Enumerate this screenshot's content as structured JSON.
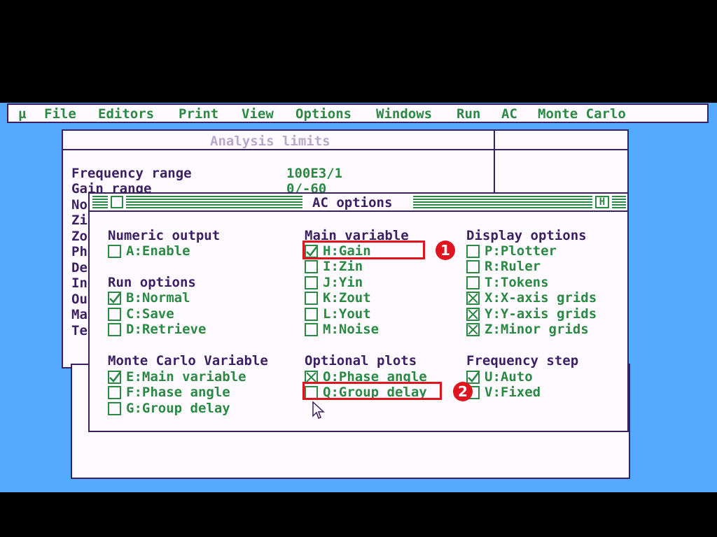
{
  "menubar": {
    "items": [
      {
        "label": "µ"
      },
      {
        "label": "File"
      },
      {
        "label": "Editors"
      },
      {
        "label": "Print"
      },
      {
        "label": "View"
      },
      {
        "label": "Options"
      },
      {
        "label": "Windows"
      },
      {
        "label": "Run"
      },
      {
        "label": "AC"
      },
      {
        "label": "Monte Carlo"
      }
    ]
  },
  "analysis_limits": {
    "title": "Analysis limits",
    "rows": [
      {
        "label": "Frequency range",
        "value": "100E3/1"
      },
      {
        "label": "Gain range",
        "value": "0/-60"
      }
    ],
    "clipped_labels": [
      "No",
      "Zi",
      "Zo",
      "Ph",
      "De",
      "In",
      "Ou",
      "Ma",
      "Te"
    ]
  },
  "dialog": {
    "title": "AC options",
    "help_label": "H",
    "groups": {
      "numeric_output": {
        "header": "Numeric output",
        "items": [
          {
            "label": "A:Enable",
            "state": "unchecked"
          }
        ]
      },
      "run_options": {
        "header": "Run options",
        "items": [
          {
            "label": "B:Normal",
            "state": "checked"
          },
          {
            "label": "C:Save",
            "state": "unchecked"
          },
          {
            "label": "D:Retrieve",
            "state": "unchecked"
          }
        ]
      },
      "monte_carlo_variable": {
        "header": "Monte Carlo Variable",
        "items": [
          {
            "label": "E:Main variable",
            "state": "checked"
          },
          {
            "label": "F:Phase angle",
            "state": "unchecked"
          },
          {
            "label": "G:Group delay",
            "state": "unchecked"
          }
        ]
      },
      "main_variable": {
        "header": "Main variable",
        "items": [
          {
            "label": "H:Gain",
            "state": "checked"
          },
          {
            "label": "I:Zin",
            "state": "unchecked"
          },
          {
            "label": "J:Yin",
            "state": "unchecked"
          },
          {
            "label": "K:Zout",
            "state": "unchecked"
          },
          {
            "label": "L:Yout",
            "state": "unchecked"
          },
          {
            "label": "M:Noise",
            "state": "unchecked"
          }
        ]
      },
      "optional_plots": {
        "header": "Optional plots",
        "items": [
          {
            "label": "O:Phase angle",
            "state": "crossed"
          },
          {
            "label": "Q:Group delay",
            "state": "unchecked"
          }
        ]
      },
      "display_options": {
        "header": "Display options",
        "items": [
          {
            "label": "P:Plotter",
            "state": "unchecked"
          },
          {
            "label": "R:Ruler",
            "state": "unchecked"
          },
          {
            "label": "T:Tokens",
            "state": "unchecked"
          },
          {
            "label": "X:X-axis grids",
            "state": "crossed"
          },
          {
            "label": "Y:Y-axis grids",
            "state": "crossed"
          },
          {
            "label": "Z:Minor grids",
            "state": "crossed"
          }
        ]
      },
      "frequency_step": {
        "header": "Frequency step",
        "items": [
          {
            "label": "U:Auto",
            "state": "checked"
          },
          {
            "label": "V:Fixed",
            "state": "unchecked"
          }
        ]
      }
    }
  },
  "annotations": [
    {
      "label": "1"
    },
    {
      "label": "2"
    }
  ],
  "colors": {
    "accent_green": "#2a8a44",
    "frame_purple": "#3b1f63",
    "desktop_blue": "#55aaff",
    "highlight_red": "#e0141e"
  }
}
